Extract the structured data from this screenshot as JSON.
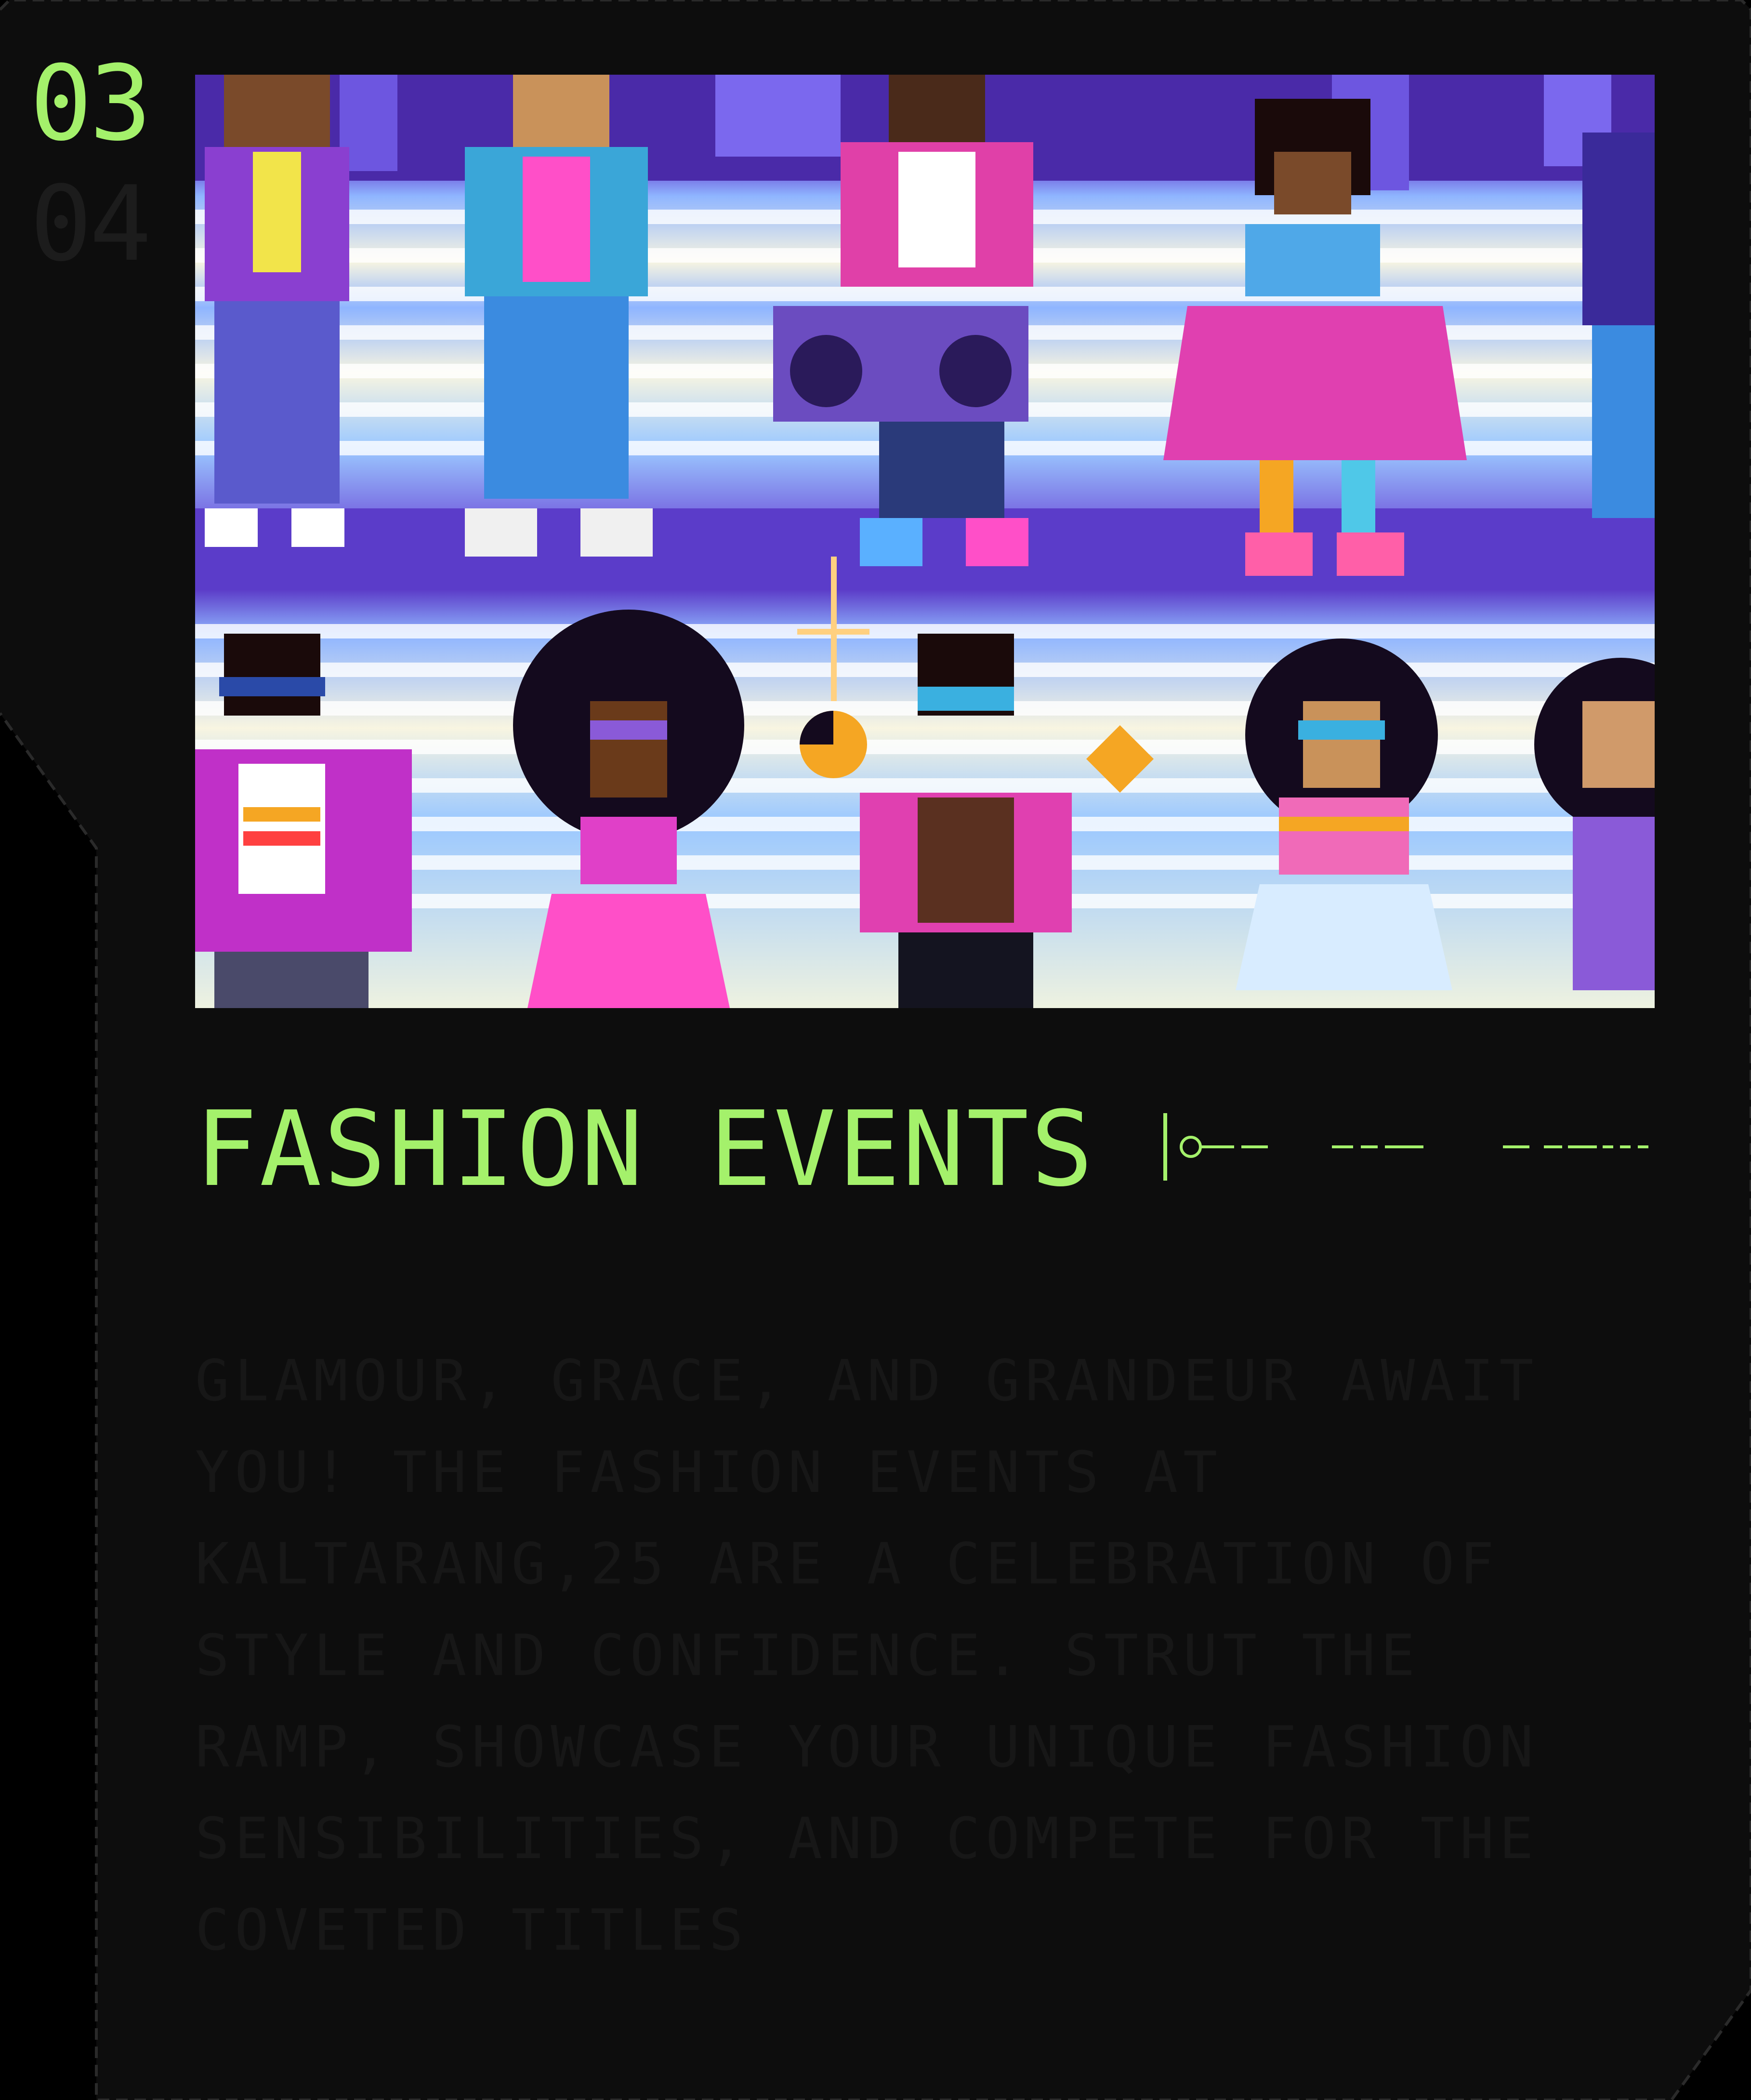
{
  "steps": {
    "current": "03",
    "next": "04"
  },
  "event": {
    "title": "FASHION EVENTS",
    "description": "GLAMOUR, GRACE, AND GRANDEUR AWAIT YOU! THE FASHION EVENTS AT KALTARANG,25 ARE A CELEBRATION OF STYLE AND CONFIDENCE. STRUT THE RAMP, SHOWCASE YOUR UNIQUE FASHION SENSIBILITIES, AND COMPETE FOR THE COVETED TITLES",
    "image_subject": "pixel-art-retro-fashion-characters"
  },
  "colors": {
    "accent": "#a4f16b",
    "card_background": "#0d0d0d",
    "page_background": "#000000",
    "muted_text": "#171717"
  }
}
